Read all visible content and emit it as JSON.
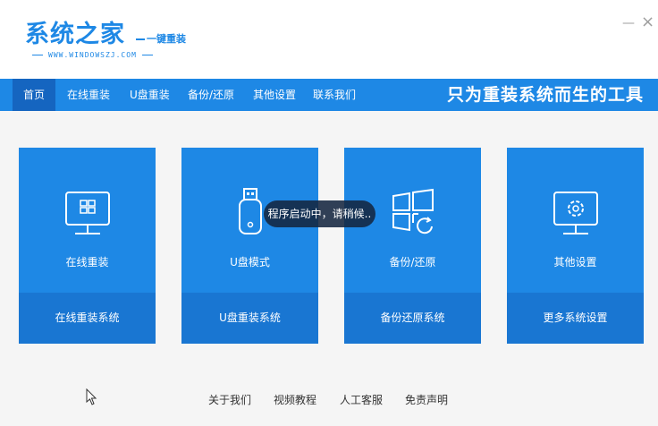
{
  "header": {
    "logo_main": "系统之家",
    "logo_sub": "一键重装",
    "logo_url": "WWW.WINDOWSZJ.COM",
    "minimize": "—",
    "close": "×"
  },
  "nav": {
    "items": [
      {
        "label": "首页",
        "active": true
      },
      {
        "label": "在线重装"
      },
      {
        "label": "U盘重装"
      },
      {
        "label": "备份/还原"
      },
      {
        "label": "其他设置"
      },
      {
        "label": "联系我们"
      }
    ],
    "slogan": "只为重装系统而生的工具"
  },
  "cards": [
    {
      "icon": "monitor-windows-icon",
      "title": "在线重装",
      "action": "在线重装系统"
    },
    {
      "icon": "usb-drive-icon",
      "title": "U盘模式",
      "action": "U盘重装系统"
    },
    {
      "icon": "windows-restore-icon",
      "title": "备份/还原",
      "action": "备份还原系统"
    },
    {
      "icon": "monitor-gear-icon",
      "title": "其他设置",
      "action": "更多系统设置"
    }
  ],
  "toast": "程序启动中，请稍候..",
  "footer": {
    "links": [
      "关于我们",
      "视频教程",
      "人工客服",
      "免责声明"
    ]
  },
  "colors": {
    "primary": "#1e88e5",
    "primary_dark": "#1976d2",
    "nav_active": "#1565c0",
    "background": "#f5f5f5"
  }
}
